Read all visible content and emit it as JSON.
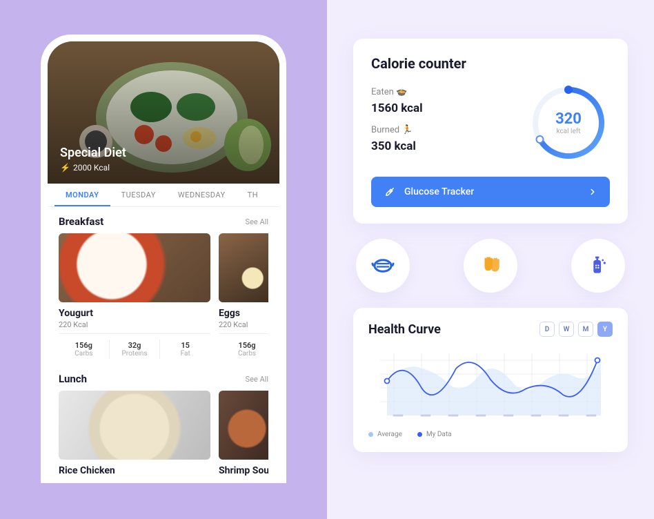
{
  "hero": {
    "title": "Special Diet",
    "kcal_label": "2000 Kcal"
  },
  "tabs": [
    "MONDAY",
    "TUESDAY",
    "WEDNESDAY",
    "TH"
  ],
  "sections": {
    "breakfast": {
      "title": "Breakfast",
      "see_all": "See All",
      "items": [
        {
          "name": "Yougurt",
          "kcal": "220 Kcal",
          "macros": [
            {
              "val": "156g",
              "lbl": "Carbs"
            },
            {
              "val": "32g",
              "lbl": "Proteins"
            },
            {
              "val": "15",
              "lbl": "Fat"
            }
          ]
        },
        {
          "name": "Eggs",
          "kcal": "220 Kcal",
          "macros": [
            {
              "val": "156g",
              "lbl": "Carbs"
            }
          ]
        }
      ]
    },
    "lunch": {
      "title": "Lunch",
      "see_all": "See All",
      "items": [
        {
          "name": "Rice Chicken"
        },
        {
          "name": "Shrimp Soup"
        }
      ]
    }
  },
  "calorie": {
    "title": "Calorie counter",
    "eaten_label": "Eaten 🍲",
    "eaten_value": "1560 kcal",
    "burned_label": "Burned 🏃",
    "burned_value": "350 kcal",
    "gauge_value": "320",
    "gauge_label": "kcal left",
    "glucose_label": "Glucose Tracker"
  },
  "icons": {
    "mask": "mask-icon",
    "gloves": "gloves-icon",
    "sanitizer": "sanitizer-icon"
  },
  "health": {
    "title": "Health Curve",
    "timeframes": [
      "D",
      "W",
      "M",
      "Y"
    ],
    "legend": [
      {
        "label": "Average",
        "color": "#a8c5f5"
      },
      {
        "label": "My Data",
        "color": "#3b5ef5"
      }
    ]
  },
  "chart_data": {
    "type": "line",
    "title": "Health Curve",
    "x": [
      0,
      1,
      2,
      3,
      4,
      5,
      6,
      7
    ],
    "series": [
      {
        "name": "Average",
        "values": [
          42,
          70,
          62,
          40,
          58,
          30,
          60,
          75
        ],
        "color": "#a8c5f5"
      },
      {
        "name": "My Data",
        "values": [
          50,
          78,
          35,
          72,
          50,
          38,
          28,
          80
        ],
        "color": "#3b5ef5"
      }
    ],
    "ylim": [
      0,
      100
    ],
    "xlabel": "",
    "ylabel": "",
    "grid": true,
    "legend_position": "bottom"
  }
}
